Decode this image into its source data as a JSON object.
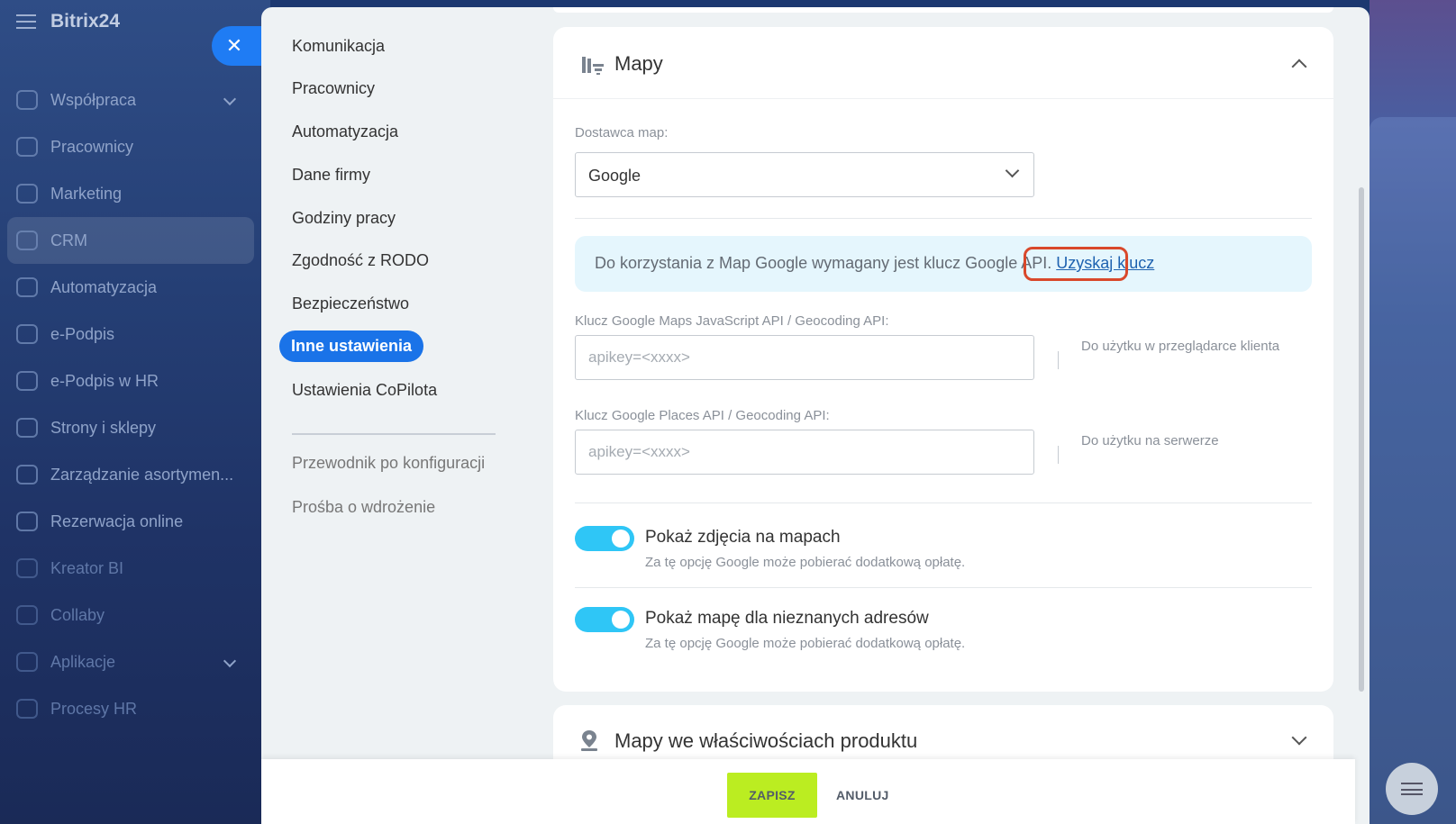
{
  "app": {
    "brand": "Bitrix24",
    "nav": [
      {
        "label": "Współpraca",
        "has_chevron": true
      },
      {
        "label": "Pracownicy"
      },
      {
        "label": "Marketing"
      },
      {
        "label": "CRM",
        "active": true
      },
      {
        "label": "Automatyzacja"
      },
      {
        "label": "e-Podpis"
      },
      {
        "label": "e-Podpis w HR"
      },
      {
        "label": "Strony i sklepy"
      },
      {
        "label": "Zarządzanie asortymen..."
      },
      {
        "label": "Rezerwacja online"
      },
      {
        "label": "Kreator BI"
      },
      {
        "label": "Collaby"
      },
      {
        "label": "Aplikacje",
        "has_chevron": true
      },
      {
        "label": "Procesy HR"
      }
    ]
  },
  "settings_menu": {
    "items": [
      {
        "label": "Komunikacja"
      },
      {
        "label": "Pracownicy"
      },
      {
        "label": "Automatyzacja"
      },
      {
        "label": "Dane firmy"
      },
      {
        "label": "Godziny pracy"
      },
      {
        "label": "Zgodność z RODO"
      },
      {
        "label": "Bezpieczeństwo"
      },
      {
        "label": "Inne ustawienia",
        "active": true
      },
      {
        "label": "Ustawienia CoPilota"
      }
    ],
    "extra": [
      {
        "label": "Przewodnik po konfiguracji"
      },
      {
        "label": "Prośba o wdrożenie"
      }
    ]
  },
  "maps_section": {
    "title": "Mapy",
    "provider_label": "Dostawca map:",
    "provider_value": "Google",
    "info_text": "Do korzystania z Map Google wymagany jest klucz Google API.",
    "info_link": "Uzyskaj klucz",
    "js_key_label": "Klucz Google Maps JavaScript API / Geocoding API:",
    "js_key_placeholder": "apikey=<xxxx>",
    "js_key_note": "Do użytku w przeglądarce klienta",
    "places_key_label": "Klucz Google Places API / Geocoding API:",
    "places_key_placeholder": "apikey=<xxxx>",
    "places_key_note": "Do użytku na serwerze",
    "toggles": [
      {
        "title": "Pokaż zdjęcia na mapach",
        "desc": "Za tę opcję Google może pobierać dodatkową opłatę.",
        "on": true
      },
      {
        "title": "Pokaż mapę dla nieznanych adresów",
        "desc": "Za tę opcję Google może pobierać dodatkową opłatę.",
        "on": true
      }
    ]
  },
  "product_maps_section": {
    "title": "Mapy we właściwościach produktu"
  },
  "footer": {
    "save_label": "ZAPISZ",
    "cancel_label": "ANULUJ"
  },
  "colors": {
    "accent": "#1a73e8",
    "toggle_on": "#2fc6f6",
    "save_button": "#bbed21",
    "highlight_outline": "#d9482b"
  }
}
